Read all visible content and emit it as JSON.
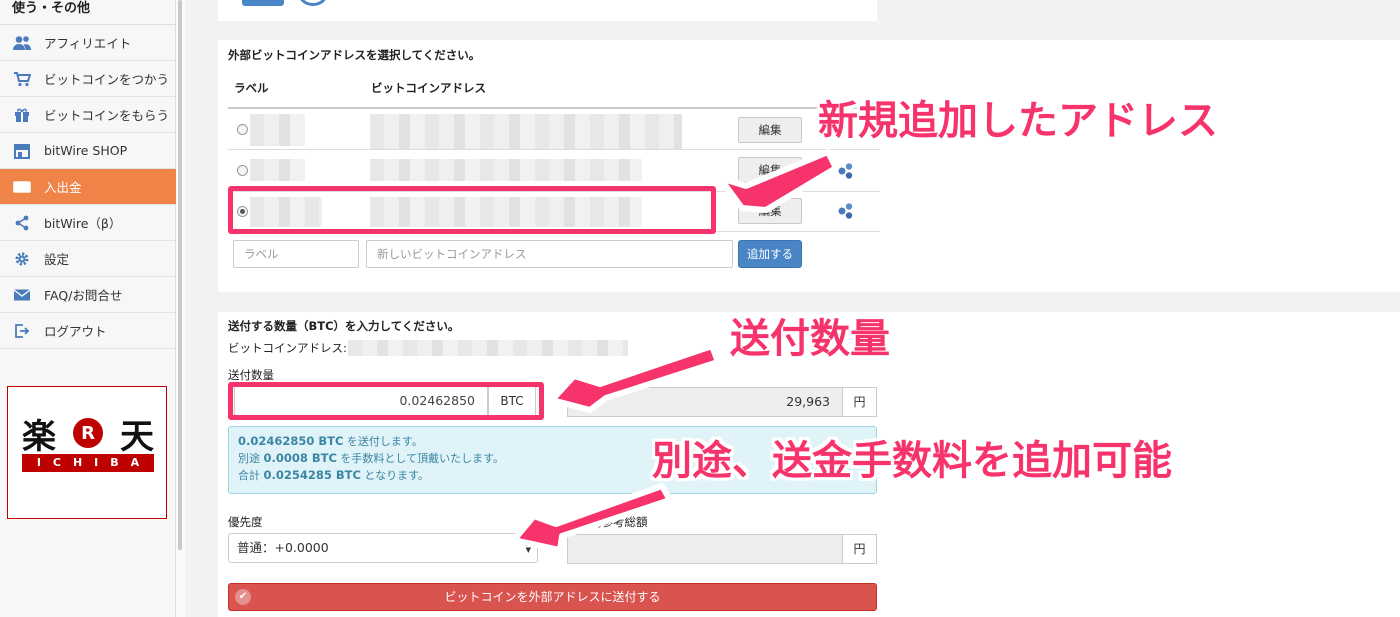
{
  "sidebar": {
    "section_title": "使う・その他",
    "items": [
      {
        "label": "アフィリエイト",
        "icon": "users-icon"
      },
      {
        "label": "ビットコインをつかう",
        "icon": "cart-icon"
      },
      {
        "label": "ビットコインをもらう",
        "icon": "gift-icon"
      },
      {
        "label": "bitWire SHOP",
        "icon": "shop-icon"
      },
      {
        "label": "入出金",
        "icon": "money-icon",
        "active": true
      },
      {
        "label": "bitWire（β）",
        "icon": "share-icon"
      },
      {
        "label": "設定",
        "icon": "gear-icon"
      },
      {
        "label": "FAQ/お問合せ",
        "icon": "mail-icon"
      },
      {
        "label": "ログアウト",
        "icon": "logout-icon"
      }
    ],
    "ad": {
      "brand": "楽天",
      "sub": "ICHIBA",
      "circle": "R"
    }
  },
  "address_panel": {
    "title": "外部ビットコインアドレスを選択してください。",
    "col_label": "ラベル",
    "col_address": "ビットコインアドレス",
    "edit_label": "編集",
    "label_placeholder": "ラベル",
    "address_placeholder": "新しいビットコインアドレス",
    "add_button": "追加する"
  },
  "send_panel": {
    "title": "送付する数量（BTC）を入力してください。",
    "address_prefix": "ビットコインアドレス: 1",
    "amount_label": "送付数量",
    "amount_value": "0.02462850",
    "amount_unit": "BTC",
    "jpy_label_partial": "総額",
    "jpy_value": "29,963",
    "jpy_unit": "円",
    "info": {
      "line1_value": "0.02462850 BTC",
      "line1_text": " を送付します。",
      "line2_prefix": "別途 ",
      "line2_value": "0.0008 BTC",
      "line2_text": " を手数料として頂戴いたします。",
      "line3_prefix": "合計 ",
      "line3_value": "0.0254285 BTC",
      "line3_text": " となります。"
    },
    "priority_label": "優先度",
    "priority_value": "普通：+0.0000",
    "jpy_ref_label": "日本円参考総額",
    "jpy_ref_unit": "円",
    "send_button": "ビットコインを外部アドレスに送付する"
  },
  "annotations": {
    "new_address": "新規追加したアドレス",
    "amount": "送付数量",
    "fee": "別途、送金手数料を追加可能"
  },
  "colors": {
    "accent": "#f7336b",
    "active_menu": "#ef8348",
    "primary_button": "#4a86c5",
    "danger_button": "#d9534f"
  }
}
